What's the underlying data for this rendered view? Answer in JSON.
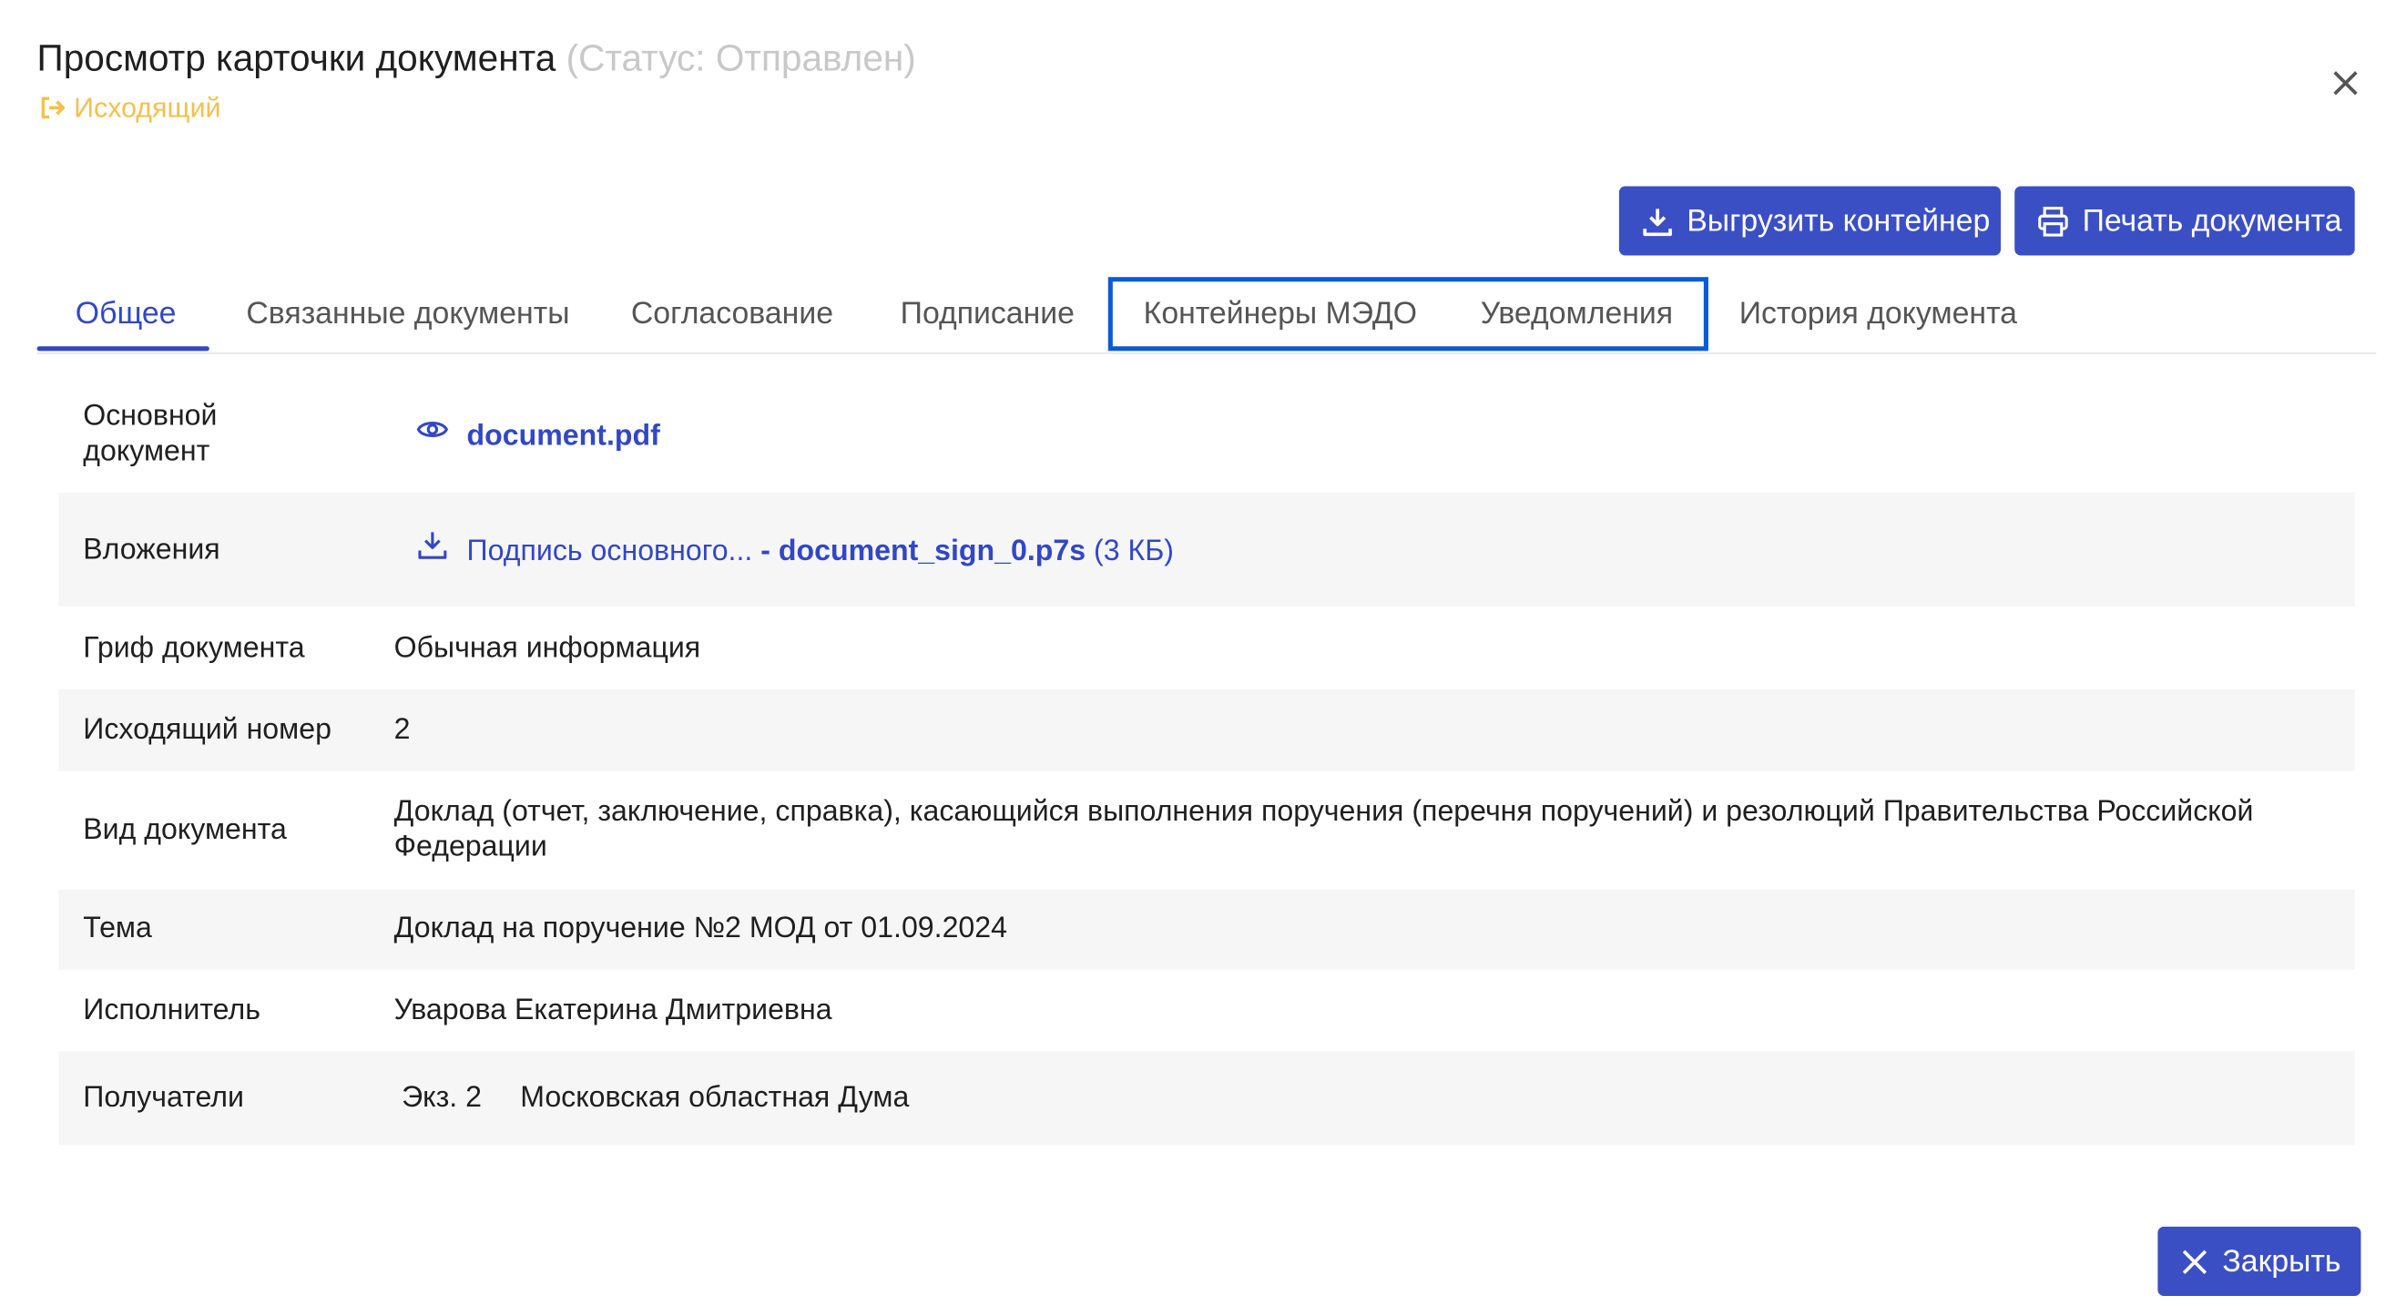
{
  "modal": {
    "title": "Просмотр карточки документа",
    "status": "(Статус: Отправлен)",
    "direction_label": "Исходящий"
  },
  "toolbar": {
    "export_label": "Выгрузить контейнер",
    "print_label": "Печать документа"
  },
  "tabs": [
    {
      "label": "Общее",
      "active": true
    },
    {
      "label": "Связанные документы",
      "active": false
    },
    {
      "label": "Согласование",
      "active": false
    },
    {
      "label": "Подписание",
      "active": false
    },
    {
      "label": "Контейнеры МЭДО",
      "active": false
    },
    {
      "label": "Уведомления",
      "active": false
    },
    {
      "label": "История документа",
      "active": false
    }
  ],
  "fields": {
    "main_document": {
      "label": "Основной документ",
      "file_name": "document.pdf"
    },
    "attachments": {
      "label": "Вложения",
      "prefix": "Подпись основного...",
      "file_name": " - document_sign_0.p7s",
      "size": "(3 КБ)"
    },
    "classification": {
      "label": "Гриф документа",
      "value": "Обычная информация"
    },
    "outgoing_number": {
      "label": "Исходящий номер",
      "value": "2"
    },
    "doc_type": {
      "label": "Вид документа",
      "value": "Доклад (отчет, заключение, справка), касающийся выполнения поручения (перечня поручений) и резолюций Правительства Российской Федерации"
    },
    "subject": {
      "label": "Тема",
      "value": "Доклад на поручение №2 МОД от 01.09.2024"
    },
    "executor": {
      "label": "Исполнитель",
      "value": "Уварова Екатерина Дмитриевна"
    },
    "recipients": {
      "label": "Получатели",
      "copy": "Экз. 2",
      "name": "Московская областная Дума"
    }
  },
  "footer": {
    "close_label": "Закрыть"
  },
  "colors": {
    "accent": "#3b4fc4",
    "link": "#3247c6",
    "status_muted": "#c8c8c8",
    "direction": "#f2c14e",
    "highlight_border": "#0a5bd3",
    "row_alt_bg": "#f6f6f6"
  },
  "icons": {
    "direction": "sign-out-icon",
    "close": "close-icon",
    "export": "download-icon",
    "print": "printer-icon",
    "preview": "eye-icon",
    "attachment": "download-icon"
  }
}
